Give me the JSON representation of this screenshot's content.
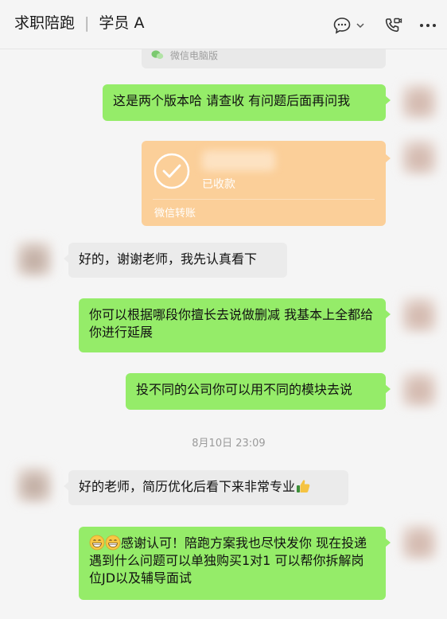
{
  "header": {
    "chat_name": "求职陪跑",
    "separator": "|",
    "contact_name": "学员 A",
    "icons": [
      "chat-bubble-icon",
      "chevron-down-icon",
      "phone-video-icon",
      "more-icon"
    ]
  },
  "messages": {
    "source_label": "微信电脑版",
    "m1": "这是两个版本哈 请查收 有问题后面再问我",
    "transfer": {
      "status": "已收款",
      "footer": "微信转账",
      "icon": "check-circle-icon"
    },
    "m3": "好的，谢谢老师，我先认真看下",
    "m4": "你可以根据哪段你擅长去说做删减 我基本上全都给你进行延展",
    "m5": "投不同的公司你可以用不同的模块去说",
    "timestamp": "8月10日 23:09",
    "m6": "好的老师，简历优化后看下来非常专业",
    "m6_emoji": "thumbs-up-icon",
    "m7": "感谢认可！陪跑方案我也尽快发你 现在投递遇到什么问题可以单独购买1对1 可以帮你拆解岗位JD以及辅导面试",
    "m7_emoji": "grinning-face-icon"
  },
  "colors": {
    "self_bubble": "#95ec69",
    "other_bubble": "#ebebeb",
    "transfer": "#fbcf99",
    "background": "#f5f5f5"
  }
}
